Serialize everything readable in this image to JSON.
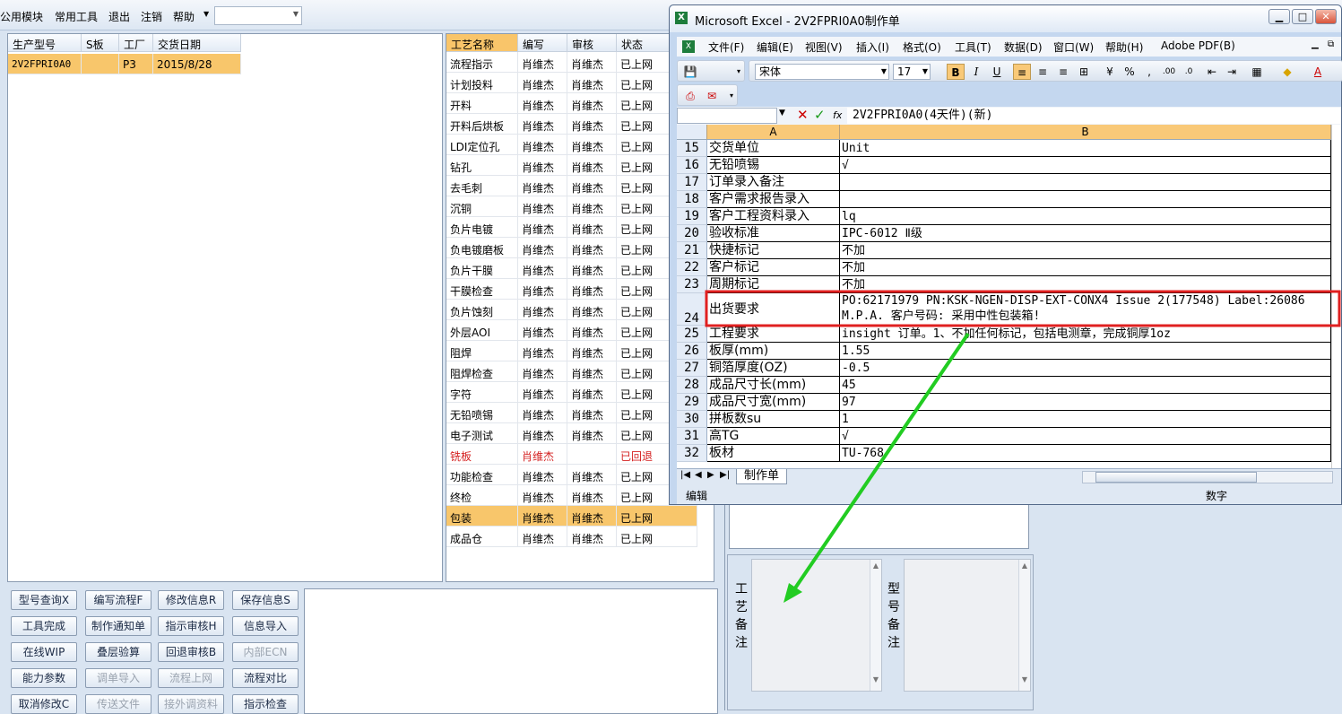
{
  "menubar": {
    "items": [
      "公用模块",
      "常用工具",
      "退出",
      "注销",
      "帮助"
    ],
    "combo_value": ""
  },
  "left_table": {
    "headers": [
      "生产型号",
      "S板",
      "工厂",
      "交货日期"
    ],
    "rows": [
      [
        "2V2FPRI0A0",
        "",
        "P3",
        "2015/8/28"
      ]
    ]
  },
  "process_table": {
    "headers": [
      "工艺名称",
      "编写",
      "审核",
      "状态"
    ],
    "rows": [
      [
        "流程指示",
        "肖维杰",
        "肖维杰",
        "已上网"
      ],
      [
        "计划投料",
        "肖维杰",
        "肖维杰",
        "已上网"
      ],
      [
        "开料",
        "肖维杰",
        "肖维杰",
        "已上网"
      ],
      [
        "开料后烘板",
        "肖维杰",
        "肖维杰",
        "已上网"
      ],
      [
        "LDI定位孔",
        "肖维杰",
        "肖维杰",
        "已上网"
      ],
      [
        "钻孔",
        "肖维杰",
        "肖维杰",
        "已上网"
      ],
      [
        "去毛刺",
        "肖维杰",
        "肖维杰",
        "已上网"
      ],
      [
        "沉铜",
        "肖维杰",
        "肖维杰",
        "已上网"
      ],
      [
        "负片电镀",
        "肖维杰",
        "肖维杰",
        "已上网"
      ],
      [
        "负电镀磨板",
        "肖维杰",
        "肖维杰",
        "已上网"
      ],
      [
        "负片干膜",
        "肖维杰",
        "肖维杰",
        "已上网"
      ],
      [
        "干膜检查",
        "肖维杰",
        "肖维杰",
        "已上网"
      ],
      [
        "负片蚀刻",
        "肖维杰",
        "肖维杰",
        "已上网"
      ],
      [
        "外层AOI",
        "肖维杰",
        "肖维杰",
        "已上网"
      ],
      [
        "阻焊",
        "肖维杰",
        "肖维杰",
        "已上网"
      ],
      [
        "阻焊检查",
        "肖维杰",
        "肖维杰",
        "已上网"
      ],
      [
        "字符",
        "肖维杰",
        "肖维杰",
        "已上网"
      ],
      [
        "无铅喷锡",
        "肖维杰",
        "肖维杰",
        "已上网"
      ],
      [
        "电子测试",
        "肖维杰",
        "肖维杰",
        "已上网"
      ],
      [
        "铣板",
        "肖维杰",
        "",
        "已回退"
      ],
      [
        "功能检查",
        "肖维杰",
        "肖维杰",
        "已上网"
      ],
      [
        "终检",
        "肖维杰",
        "肖维杰",
        "已上网"
      ],
      [
        "包装",
        "肖维杰",
        "肖维杰",
        "已上网"
      ],
      [
        "成品仓",
        "肖维杰",
        "肖维杰",
        "已上网"
      ]
    ],
    "red_row": 19,
    "selected_row": 22
  },
  "buttons": [
    [
      "型号查询X",
      "编写流程F",
      "修改信息R",
      "保存信息S"
    ],
    [
      "工具完成",
      "制作通知单",
      "指示审核H",
      "信息导入"
    ],
    [
      "在线WIP",
      "叠层验算",
      "回退审核B",
      "内部ECN"
    ],
    [
      "能力参数",
      "调单导入",
      "流程上网",
      "流程对比"
    ],
    [
      "取消修改C",
      "传送文件",
      "接外调资料",
      "指示检查"
    ]
  ],
  "buttons_disabled": [
    "内部ECN",
    "调单导入",
    "流程上网",
    "传送文件",
    "接外调资料"
  ],
  "notes": {
    "process_note_label": "工艺备注",
    "model_note_label": "型号备注"
  },
  "excel": {
    "title": "Microsoft Excel - 2V2FPRI0A0制作单",
    "menu": [
      "文件(F)",
      "编辑(E)",
      "视图(V)",
      "插入(I)",
      "格式(O)",
      "工具(T)",
      "数据(D)",
      "窗口(W)",
      "帮助(H)",
      "Adobe PDF(B)"
    ],
    "font_name": "宋体",
    "font_size": "17",
    "formula": "2V2FPRI0A0(4天件)(新)",
    "col_a": "A",
    "col_b": "B",
    "rows": [
      [
        "15",
        "交货单位",
        "Unit"
      ],
      [
        "16",
        "无铅喷锡",
        "√"
      ],
      [
        "17",
        "订单录入备注",
        ""
      ],
      [
        "18",
        "客户需求报告录入",
        ""
      ],
      [
        "19",
        "客户工程资料录入",
        "lq"
      ],
      [
        "20",
        "验收标准",
        "IPC-6012 Ⅱ级"
      ],
      [
        "21",
        "快捷标记",
        "不加"
      ],
      [
        "22",
        "客户标记",
        "不加"
      ],
      [
        "23",
        "周期标记",
        "不加"
      ],
      [
        "24",
        "出货要求",
        "PO:62171979 PN:KSK-NGEN-DISP-EXT-CONX4 Issue 2(177548) Label:26086"
      ],
      [
        "25",
        "工程要求",
        "insight 订单。1、不加任何标记，包括电测章，完成铜厚1oz"
      ],
      [
        "26",
        "板厚(mm)",
        "1.55"
      ],
      [
        "27",
        "铜箔厚度(OZ)",
        "-0.5"
      ],
      [
        "28",
        "成品尺寸长(mm)",
        "45"
      ],
      [
        "29",
        "成品尺寸宽(mm)",
        "97"
      ],
      [
        "30",
        "拼板数su",
        "1"
      ],
      [
        "31",
        "高TG",
        "√"
      ],
      [
        "32",
        "板材",
        "TU-768"
      ]
    ],
    "row24_line2": "M.P.A. 客户号码: 采用中性包装箱!",
    "sheet_tab": "制作单",
    "status_left": "编辑",
    "status_right": "数字"
  },
  "colors": {
    "highlight": "#e02020",
    "arrow": "#22cc22",
    "selection": "#f8c66b"
  }
}
